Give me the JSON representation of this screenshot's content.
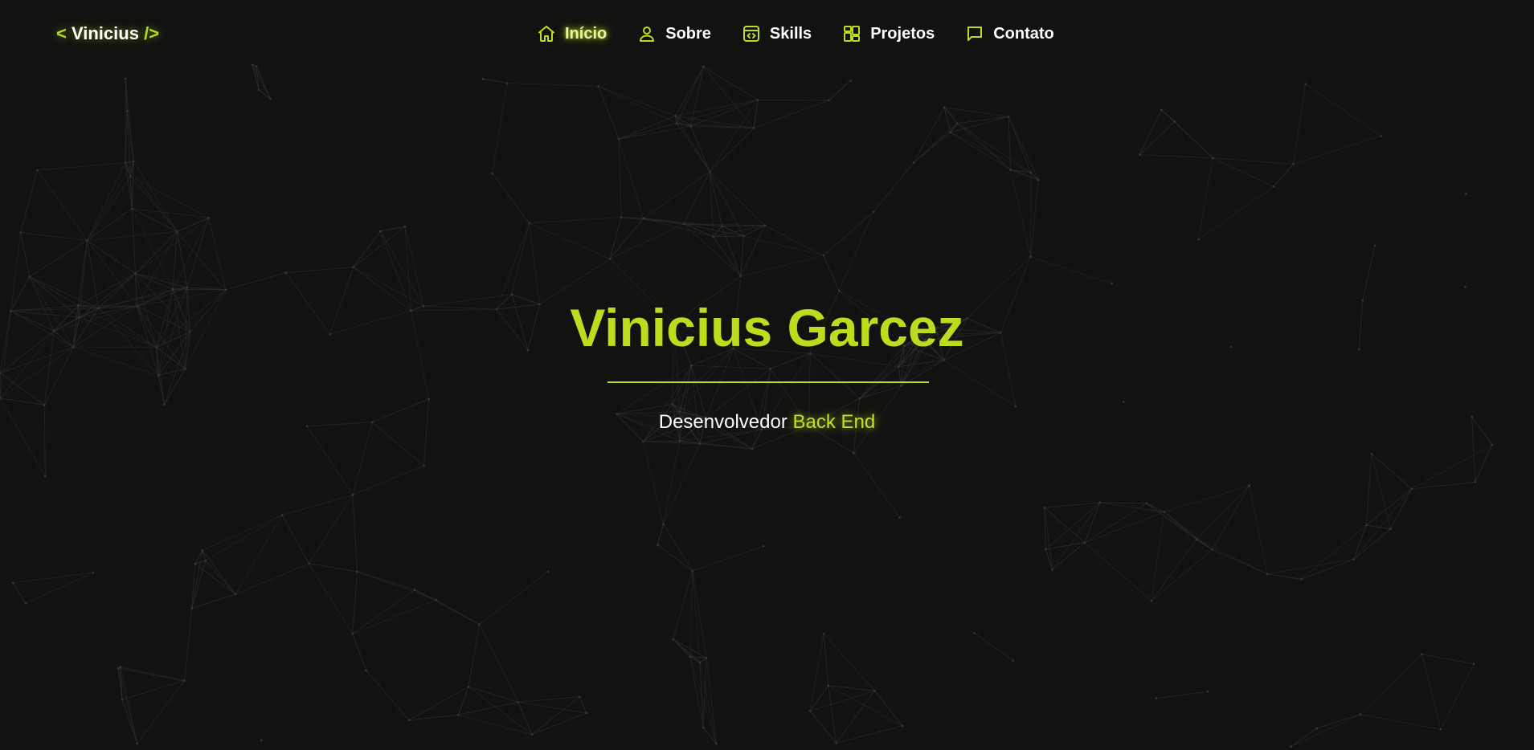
{
  "header": {
    "logo": {
      "open": "<",
      "name": "Vinicius",
      "close": "/>"
    },
    "nav": [
      {
        "label": "Início",
        "icon": "home-icon",
        "active": true
      },
      {
        "label": "Sobre",
        "icon": "user-icon",
        "active": false
      },
      {
        "label": "Skills",
        "icon": "code-window-icon",
        "active": false
      },
      {
        "label": "Projetos",
        "icon": "grid-icon",
        "active": false
      },
      {
        "label": "Contato",
        "icon": "chat-icon",
        "active": false
      }
    ]
  },
  "hero": {
    "title": "Vinicius Garcez",
    "subtitle_prefix": "Desenvolvedor",
    "subtitle_accent": "Back End"
  },
  "colors": {
    "background": "#111311",
    "accent": "#bcdc1e",
    "text": "#ffffff"
  }
}
